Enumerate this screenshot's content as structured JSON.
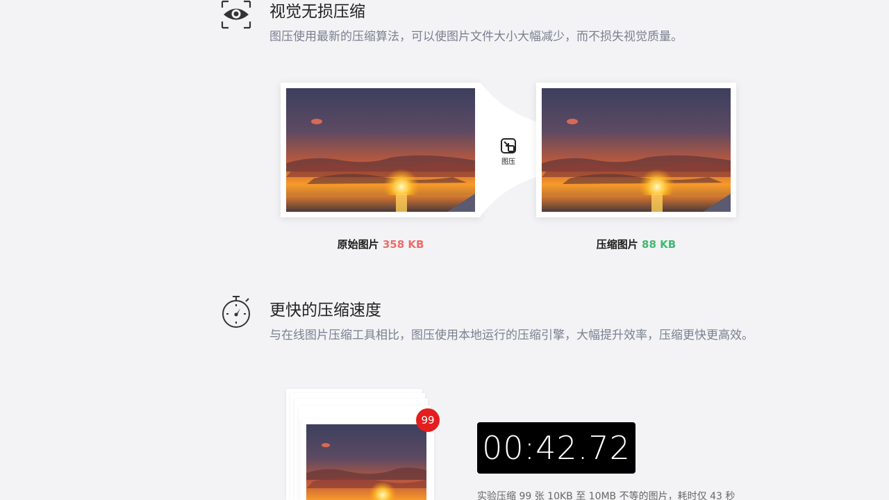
{
  "lossless": {
    "icon": "eye-scan-icon",
    "title": "视觉无损压缩",
    "description": "图压使用最新的压缩算法，可以使图片文件大小大幅减少，而不损失视觉质量。",
    "original_label": "原始图片",
    "original_size": "358 KB",
    "compressed_label": "压缩图片",
    "compressed_size": "88 KB",
    "compress_badge_label": "图压",
    "compress_icon": "compress-icon",
    "colors": {
      "original_size": "#ef6a6a",
      "compressed_size": "#3fba6e"
    }
  },
  "speed": {
    "icon": "stopwatch-icon",
    "title": "更快的压缩速度",
    "description": "与在线图片压缩工具相比，图压使用本地运行的压缩引擎，大幅提升效率，压缩更快更高效。",
    "stack_count": "99",
    "timer": "00:42.72",
    "note": "实验压缩 99 张 10KB 至 10MB 不等的图片，耗时仅 43 秒",
    "colors": {
      "badge": "#e41e1e",
      "timer_bg": "#000000"
    }
  }
}
